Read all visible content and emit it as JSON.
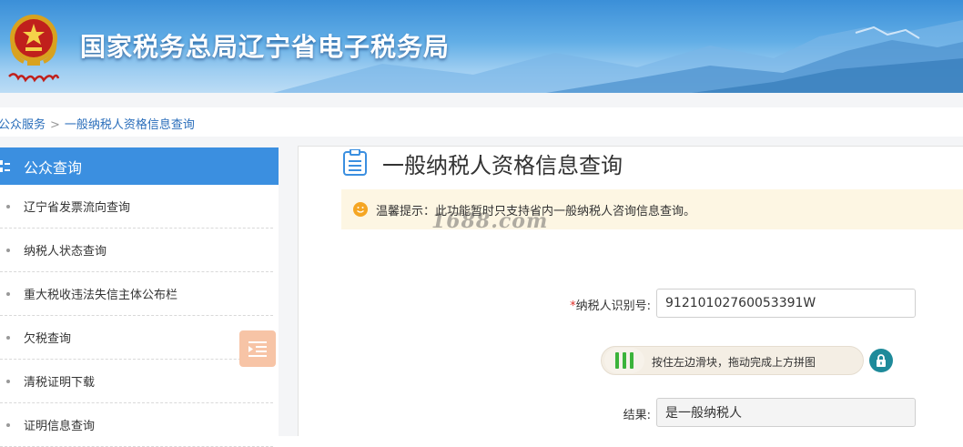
{
  "header": {
    "title": "国家税务总局辽宁省电子税务局",
    "emblem_text": "中国税务"
  },
  "breadcrumb": {
    "items": [
      "公众服务",
      "一般纳税人资格信息查询"
    ],
    "separator": ">"
  },
  "sidebar": {
    "heading": "公众查询",
    "items": [
      {
        "label": "辽宁省发票流向查询"
      },
      {
        "label": "纳税人状态查询"
      },
      {
        "label": "重大税收违法失信主体公布栏"
      },
      {
        "label": "欠税查询"
      },
      {
        "label": "清税证明下载"
      },
      {
        "label": "证明信息查询"
      }
    ]
  },
  "main": {
    "title": "一般纳税人资格信息查询",
    "notice": "温馨提示：此功能暂时只支持省内一般纳税人咨询信息查询。",
    "watermark": "1688.com",
    "form": {
      "taxpayer_id_required_mark": "*",
      "taxpayer_id_label": "纳税人识别号:",
      "taxpayer_id_value": "91210102760053391W",
      "slider_hint": "按住左边滑块，拖动完成上方拼图",
      "result_label": "结果:",
      "result_value": "是一般纳税人"
    }
  },
  "colors": {
    "accent_blue": "#3b8fe0",
    "notice_bg": "#fdf6e3",
    "required_red": "#e0322c",
    "slider_green": "#3bb33b",
    "lock_teal": "#1e8a9a"
  }
}
